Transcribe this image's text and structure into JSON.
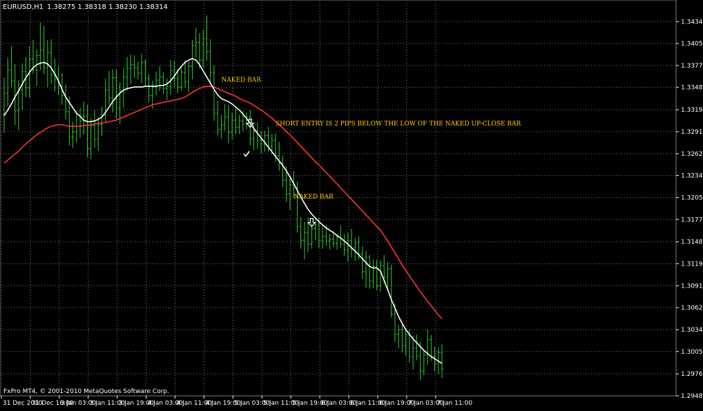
{
  "header": {
    "symbol": "EURUSD,H1",
    "ohlc": "1.38275 1.38318 1.38230 1.38314"
  },
  "footer": {
    "copyright": "FxPro MT4, © 2001-2010 MetaQuotes Software Corp."
  },
  "colors": {
    "background": "#000000",
    "grid": "#808080",
    "bars": "#33cc33",
    "fast_ma": "#ffffff",
    "slow_ma": "#ff3333",
    "annotation": "#ffcc00",
    "text": "#ffffff"
  },
  "chart_data": {
    "type": "ohlc",
    "title": "",
    "xlabel": "",
    "ylabel": "",
    "ylim": [
      1.2948,
      1.3462
    ],
    "yticks": [
      1.3434,
      1.34055,
      1.3377,
      1.33485,
      1.33195,
      1.3291,
      1.32625,
      1.3234,
      1.32055,
      1.3177,
      1.3148,
      1.31195,
      1.3091,
      1.30625,
      1.3034,
      1.30055,
      1.29765,
      1.2948
    ],
    "ytick_labels": [
      "1.34340",
      "1.34055",
      "1.33770",
      "1.33485",
      "1.33195",
      "1.32910",
      "1.32625",
      "1.32340",
      "1.32055",
      "1.31770",
      "1.31480",
      "1.31195",
      "1.30910",
      "1.30625",
      "1.30340",
      "1.30055",
      "1.29765",
      "1.29480"
    ],
    "xtick_labels": [
      "31 Dec 2010",
      "31 Dec 16:00",
      "3 Jan 03:00",
      "3 Jan 11:00",
      "3 Jan 19:00",
      "4 Jan 03:00",
      "4 Jan 11:00",
      "4 Jan 19:00",
      "5 Jan 03:00",
      "5 Jan 11:00",
      "5 Jan 19:00",
      "6 Jan 03:00",
      "6 Jan 11:00",
      "6 Jan 19:00",
      "7 Jan 03:00",
      "7 Jan 11:00"
    ],
    "grid": true,
    "bar_count": 122,
    "series": [
      {
        "kind": "ohlc",
        "values": [
          [
            1.3313,
            1.3361,
            1.329,
            1.3341
          ],
          [
            1.3341,
            1.3387,
            1.3324,
            1.3371
          ],
          [
            1.3371,
            1.3402,
            1.3349,
            1.3357
          ],
          [
            1.3357,
            1.3379,
            1.33,
            1.3318
          ],
          [
            1.3318,
            1.3358,
            1.3293,
            1.3345
          ],
          [
            1.3345,
            1.338,
            1.3319,
            1.3369
          ],
          [
            1.3369,
            1.3388,
            1.3336,
            1.3348
          ],
          [
            1.3348,
            1.3402,
            1.3335,
            1.3385
          ],
          [
            1.3385,
            1.341,
            1.3366,
            1.3371
          ],
          [
            1.3371,
            1.3398,
            1.335,
            1.339
          ],
          [
            1.339,
            1.3433,
            1.3371,
            1.3397
          ],
          [
            1.3397,
            1.3428,
            1.3366,
            1.3374
          ],
          [
            1.3374,
            1.341,
            1.3349,
            1.3394
          ],
          [
            1.3394,
            1.3411,
            1.3353,
            1.3365
          ],
          [
            1.3365,
            1.3386,
            1.3343,
            1.3359
          ],
          [
            1.3359,
            1.3376,
            1.3339,
            1.335
          ],
          [
            1.335,
            1.3367,
            1.3326,
            1.3338
          ],
          [
            1.3338,
            1.3352,
            1.3307,
            1.3317
          ],
          [
            1.3317,
            1.3337,
            1.3273,
            1.3284
          ],
          [
            1.3284,
            1.3304,
            1.327,
            1.3291
          ],
          [
            1.3291,
            1.3318,
            1.3277,
            1.3298
          ],
          [
            1.3298,
            1.3322,
            1.3283,
            1.3305
          ],
          [
            1.3305,
            1.333,
            1.3287,
            1.3311
          ],
          [
            1.3311,
            1.3326,
            1.3258,
            1.3269
          ],
          [
            1.3269,
            1.3309,
            1.3255,
            1.3299
          ],
          [
            1.3299,
            1.3319,
            1.327,
            1.3281
          ],
          [
            1.3281,
            1.331,
            1.3266,
            1.33
          ],
          [
            1.33,
            1.3323,
            1.3286,
            1.3312
          ],
          [
            1.3312,
            1.336,
            1.3303,
            1.3345
          ],
          [
            1.3345,
            1.337,
            1.3326,
            1.3335
          ],
          [
            1.3335,
            1.3372,
            1.3316,
            1.3361
          ],
          [
            1.3361,
            1.3372,
            1.3308,
            1.3322
          ],
          [
            1.3322,
            1.3355,
            1.3301,
            1.3344
          ],
          [
            1.3344,
            1.3374,
            1.3322,
            1.3362
          ],
          [
            1.3362,
            1.3388,
            1.3344,
            1.3373
          ],
          [
            1.3373,
            1.3391,
            1.3353,
            1.3378
          ],
          [
            1.3378,
            1.339,
            1.3361,
            1.3374
          ],
          [
            1.3374,
            1.3382,
            1.3359,
            1.3367
          ],
          [
            1.3367,
            1.3392,
            1.3354,
            1.3381
          ],
          [
            1.3381,
            1.3385,
            1.3349,
            1.336
          ],
          [
            1.336,
            1.3366,
            1.3329,
            1.3338
          ],
          [
            1.3338,
            1.3357,
            1.3321,
            1.3349
          ],
          [
            1.3349,
            1.3369,
            1.3338,
            1.3358
          ],
          [
            1.3358,
            1.3376,
            1.3344,
            1.3362
          ],
          [
            1.3362,
            1.3368,
            1.334,
            1.3347
          ],
          [
            1.3347,
            1.336,
            1.3332,
            1.335
          ],
          [
            1.335,
            1.3384,
            1.3339,
            1.337
          ],
          [
            1.337,
            1.3383,
            1.3348,
            1.336
          ],
          [
            1.336,
            1.3372,
            1.3341,
            1.3349
          ],
          [
            1.3349,
            1.3375,
            1.3344,
            1.3368
          ],
          [
            1.3368,
            1.3384,
            1.3348,
            1.3356
          ],
          [
            1.3356,
            1.3382,
            1.3342,
            1.3376
          ],
          [
            1.3376,
            1.341,
            1.3359,
            1.3403
          ],
          [
            1.3403,
            1.3426,
            1.3387,
            1.3407
          ],
          [
            1.3407,
            1.3419,
            1.3373,
            1.3384
          ],
          [
            1.3384,
            1.3423,
            1.3374,
            1.3412
          ],
          [
            1.3412,
            1.3442,
            1.3383,
            1.3395
          ],
          [
            1.3395,
            1.3411,
            1.3352,
            1.3368
          ],
          [
            1.3368,
            1.3377,
            1.3305,
            1.3315
          ],
          [
            1.3315,
            1.3331,
            1.3286,
            1.3294
          ],
          [
            1.3294,
            1.3313,
            1.3282,
            1.33
          ],
          [
            1.33,
            1.3327,
            1.3292,
            1.331
          ],
          [
            1.331,
            1.3326,
            1.3276,
            1.329
          ],
          [
            1.329,
            1.3316,
            1.3281,
            1.3306
          ],
          [
            1.3306,
            1.3321,
            1.3288,
            1.3297
          ],
          [
            1.3297,
            1.3313,
            1.3288,
            1.3305
          ],
          [
            1.3305,
            1.3318,
            1.3292,
            1.3301
          ],
          [
            1.3301,
            1.3316,
            1.3294,
            1.331
          ],
          [
            1.331,
            1.3319,
            1.3273,
            1.3282
          ],
          [
            1.3282,
            1.33,
            1.3267,
            1.3292
          ],
          [
            1.3292,
            1.3303,
            1.3269,
            1.328
          ],
          [
            1.328,
            1.3292,
            1.3263,
            1.3275
          ],
          [
            1.3275,
            1.3292,
            1.3265,
            1.3286
          ],
          [
            1.3286,
            1.3297,
            1.3265,
            1.3272
          ],
          [
            1.3272,
            1.3288,
            1.3262,
            1.328
          ],
          [
            1.328,
            1.3289,
            1.3252,
            1.326
          ],
          [
            1.326,
            1.3278,
            1.324,
            1.325
          ],
          [
            1.325,
            1.326,
            1.3219,
            1.3228
          ],
          [
            1.3228,
            1.3246,
            1.32,
            1.321
          ],
          [
            1.321,
            1.3231,
            1.3189,
            1.3222
          ],
          [
            1.3222,
            1.324,
            1.3205,
            1.3218
          ],
          [
            1.3218,
            1.3226,
            1.316,
            1.3168
          ],
          [
            1.3168,
            1.318,
            1.3139,
            1.315
          ],
          [
            1.315,
            1.3174,
            1.3125,
            1.316
          ],
          [
            1.316,
            1.318,
            1.3135,
            1.3145
          ],
          [
            1.3145,
            1.3172,
            1.3139,
            1.3165
          ],
          [
            1.3165,
            1.318,
            1.315,
            1.317
          ],
          [
            1.317,
            1.318,
            1.314,
            1.315
          ],
          [
            1.315,
            1.3168,
            1.3139,
            1.3155
          ],
          [
            1.3155,
            1.317,
            1.3143,
            1.3149
          ],
          [
            1.3149,
            1.3158,
            1.3138,
            1.3151
          ],
          [
            1.3151,
            1.3162,
            1.3141,
            1.3146
          ],
          [
            1.3146,
            1.3158,
            1.3138,
            1.3154
          ],
          [
            1.3154,
            1.3169,
            1.314,
            1.3145
          ],
          [
            1.3145,
            1.3158,
            1.313,
            1.3138
          ],
          [
            1.3138,
            1.316,
            1.3122,
            1.315
          ],
          [
            1.315,
            1.3165,
            1.3128,
            1.314
          ],
          [
            1.314,
            1.3153,
            1.3123,
            1.3146
          ],
          [
            1.3146,
            1.3155,
            1.3125,
            1.3132
          ],
          [
            1.3132,
            1.3142,
            1.31,
            1.3109
          ],
          [
            1.3109,
            1.3136,
            1.3088,
            1.3128
          ],
          [
            1.3128,
            1.3131,
            1.3087,
            1.3097
          ],
          [
            1.3097,
            1.3125,
            1.3088,
            1.3116
          ],
          [
            1.3116,
            1.3125,
            1.3085,
            1.3091
          ],
          [
            1.3091,
            1.3124,
            1.3083,
            1.3117
          ],
          [
            1.3117,
            1.3131,
            1.3094,
            1.3102
          ],
          [
            1.3102,
            1.3121,
            1.3087,
            1.3113
          ],
          [
            1.3113,
            1.3118,
            1.305,
            1.3054
          ],
          [
            1.3054,
            1.3068,
            1.3018,
            1.3028
          ],
          [
            1.3028,
            1.304,
            1.301,
            1.3034
          ],
          [
            1.3034,
            1.3044,
            1.3004,
            1.3013
          ],
          [
            1.3013,
            1.3034,
            1.3,
            1.3027
          ],
          [
            1.3027,
            1.3035,
            1.2991,
            1.2999
          ],
          [
            1.2999,
            1.3026,
            1.2982,
            1.301
          ],
          [
            1.301,
            1.3028,
            1.2994,
            1.3
          ],
          [
            1.3,
            1.3018,
            1.2969,
            1.298
          ],
          [
            1.298,
            1.3008,
            1.2975,
            1.3001
          ],
          [
            1.3001,
            1.3034,
            1.2988,
            1.3021
          ],
          [
            1.3021,
            1.3027,
            1.2993,
            1.2999
          ],
          [
            1.2999,
            1.3012,
            1.298,
            1.299
          ],
          [
            1.299,
            1.3011,
            1.2976,
            1.3004
          ],
          [
            1.3004,
            1.3015,
            1.2971,
            1.2983
          ]
        ]
      },
      {
        "kind": "ma",
        "role": "fast",
        "color": "#ffffff",
        "values": [
          1.3312,
          1.3319,
          1.3327,
          1.3336,
          1.3344,
          1.3353,
          1.3361,
          1.3368,
          1.3374,
          1.3378,
          1.338,
          1.3381,
          1.3379,
          1.3374,
          1.3366,
          1.3357,
          1.3346,
          1.3336,
          1.3329,
          1.3322,
          1.3315,
          1.3311,
          1.3306,
          1.3304,
          1.3304,
          1.3305,
          1.3307,
          1.331,
          1.3316,
          1.3323,
          1.333,
          1.3336,
          1.3341,
          1.3345,
          1.3347,
          1.3348,
          1.3349,
          1.3349,
          1.3349,
          1.335,
          1.335,
          1.335,
          1.335,
          1.3351,
          1.3351,
          1.3353,
          1.3357,
          1.3363,
          1.337,
          1.3376,
          1.3381,
          1.3384,
          1.3386,
          1.3384,
          1.3378,
          1.337,
          1.3362,
          1.3354,
          1.3346,
          1.3339,
          1.3334,
          1.3332,
          1.333,
          1.3327,
          1.3323,
          1.3319,
          1.3314,
          1.3308,
          1.3302,
          1.3295,
          1.3289,
          1.3283,
          1.3277,
          1.3271,
          1.3265,
          1.3259,
          1.3253,
          1.3247,
          1.324,
          1.3232,
          1.3224,
          1.3215,
          1.3206,
          1.3198,
          1.319,
          1.3184,
          1.3179,
          1.3174,
          1.317,
          1.3166,
          1.3163,
          1.316,
          1.3156,
          1.3153,
          1.3149,
          1.3145,
          1.314,
          1.3136,
          1.3131,
          1.3126,
          1.3121,
          1.3116,
          1.3114,
          1.3114,
          1.311,
          1.3098,
          1.3086,
          1.3073,
          1.3062,
          1.3051,
          1.3042,
          1.3034,
          1.3028,
          1.3022,
          1.3017,
          1.3012,
          1.3007,
          1.3003,
          1.2999,
          1.2996,
          1.2993,
          1.299
        ]
      },
      {
        "kind": "ma",
        "role": "slow",
        "color": "#ff3333",
        "values": [
          1.325,
          1.3254,
          1.3258,
          1.3262,
          1.3266,
          1.3271,
          1.3275,
          1.3279,
          1.3283,
          1.3287,
          1.329,
          1.3293,
          1.3296,
          1.3298,
          1.3299,
          1.33,
          1.33,
          1.3299,
          1.3298,
          1.3298,
          1.3298,
          1.3298,
          1.3299,
          1.3299,
          1.33,
          1.3301,
          1.3302,
          1.3302,
          1.3303,
          1.3304,
          1.3305,
          1.3306,
          1.3308,
          1.331,
          1.3312,
          1.3314,
          1.3316,
          1.3318,
          1.332,
          1.3322,
          1.3324,
          1.3326,
          1.3327,
          1.3328,
          1.3329,
          1.333,
          1.3331,
          1.3332,
          1.3333,
          1.3334,
          1.3336,
          1.3339,
          1.3342,
          1.3345,
          1.3347,
          1.3349,
          1.335,
          1.335,
          1.3349,
          1.3347,
          1.3345,
          1.3343,
          1.3341,
          1.3339,
          1.3337,
          1.3334,
          1.3332,
          1.333,
          1.3328,
          1.3325,
          1.3322,
          1.3319,
          1.3316,
          1.3312,
          1.3309,
          1.3304,
          1.33,
          1.3296,
          1.3291,
          1.3287,
          1.3282,
          1.3277,
          1.3272,
          1.3267,
          1.3262,
          1.3257,
          1.3252,
          1.3248,
          1.3243,
          1.3238,
          1.3233,
          1.3228,
          1.3223,
          1.3218,
          1.3213,
          1.3208,
          1.3203,
          1.3198,
          1.3193,
          1.3188,
          1.3183,
          1.3178,
          1.3173,
          1.3168,
          1.3163,
          1.3156,
          1.3149,
          1.3141,
          1.3134,
          1.3126,
          1.3118,
          1.3111,
          1.3104,
          1.3097,
          1.309,
          1.3083,
          1.3077,
          1.3071,
          1.3065,
          1.3059,
          1.3053,
          1.3048
        ]
      }
    ],
    "annotations": [
      {
        "text": "NAKED BAR",
        "x_bar": 60,
        "y": 1.3356
      },
      {
        "text": "SHORT ENTRY IS 2 PIPS BELOW THE LOW OF THE NAKED UP-CLOSE BAR",
        "x_bar": 75,
        "y": 1.3299
      },
      {
        "text": "NAKED BAR",
        "x_bar": 80,
        "y": 1.3204
      }
    ],
    "markers": [
      {
        "type": "down-arrow",
        "x_bar": 68,
        "y": 1.3302
      },
      {
        "type": "check",
        "x_bar": 67,
        "y": 1.3262
      },
      {
        "type": "down-arrow",
        "x_bar": 85,
        "y": 1.3173
      }
    ]
  }
}
